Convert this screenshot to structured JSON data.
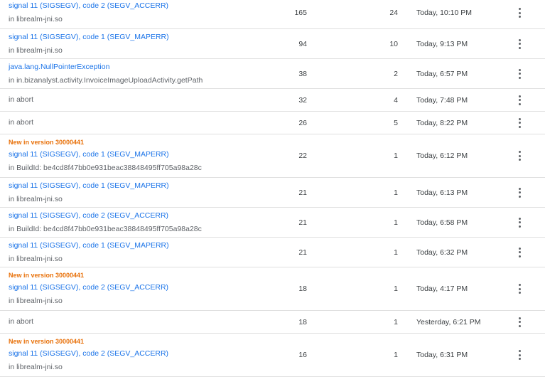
{
  "rows": [
    {
      "new": "",
      "issue": "signal 11 (SIGSEGV), code 2 (SEGV_ACCERR)",
      "location": "in librealm-jni.so",
      "events": "165",
      "users": "24",
      "time": "Today, 10:10 PM"
    },
    {
      "new": "",
      "issue": "signal 11 (SIGSEGV), code 1 (SEGV_MAPERR)",
      "location": "in librealm-jni.so",
      "events": "94",
      "users": "10",
      "time": "Today, 9:13 PM"
    },
    {
      "new": "",
      "issue": "java.lang.NullPointerException",
      "location": "in in.bizanalyst.activity.InvoiceImageUploadActivity.getPath",
      "events": "38",
      "users": "2",
      "time": "Today, 6:57 PM"
    },
    {
      "new": "",
      "issue": "",
      "location": "in abort",
      "events": "32",
      "users": "4",
      "time": "Today, 7:48 PM"
    },
    {
      "new": "",
      "issue": "",
      "location": "in abort",
      "events": "26",
      "users": "5",
      "time": "Today, 8:22 PM"
    },
    {
      "new": "New in version 30000441",
      "issue": "signal 11 (SIGSEGV), code 1 (SEGV_MAPERR)",
      "location": "in BuildId: be4cd8f47bb0e931beac38848495ff705a98a28c",
      "events": "22",
      "users": "1",
      "time": "Today, 6:12 PM"
    },
    {
      "new": "",
      "issue": "signal 11 (SIGSEGV), code 1 (SEGV_MAPERR)",
      "location": "in librealm-jni.so",
      "events": "21",
      "users": "1",
      "time": "Today, 6:13 PM"
    },
    {
      "new": "",
      "issue": "signal 11 (SIGSEGV), code 2 (SEGV_ACCERR)",
      "location": "in BuildId: be4cd8f47bb0e931beac38848495ff705a98a28c",
      "events": "21",
      "users": "1",
      "time": "Today, 6:58 PM"
    },
    {
      "new": "",
      "issue": "signal 11 (SIGSEGV), code 1 (SEGV_MAPERR)",
      "location": "in librealm-jni.so",
      "events": "21",
      "users": "1",
      "time": "Today, 6:32 PM"
    },
    {
      "new": "New in version 30000441",
      "issue": "signal 11 (SIGSEGV), code 2 (SEGV_ACCERR)",
      "location": "in librealm-jni.so",
      "events": "18",
      "users": "1",
      "time": "Today, 4:17 PM"
    },
    {
      "new": "",
      "issue": "",
      "location": "in abort",
      "events": "18",
      "users": "1",
      "time": "Yesterday, 6:21 PM"
    },
    {
      "new": "New in version 30000441",
      "issue": "signal 11 (SIGSEGV), code 2 (SEGV_ACCERR)",
      "location": "in librealm-jni.so",
      "events": "16",
      "users": "1",
      "time": "Today, 6:31 PM"
    }
  ],
  "icons": {
    "row_menu": "more-vert-icon"
  },
  "colors": {
    "link": "#1a73e8",
    "new_badge": "#e8710a",
    "secondary_text": "#5f6368"
  }
}
